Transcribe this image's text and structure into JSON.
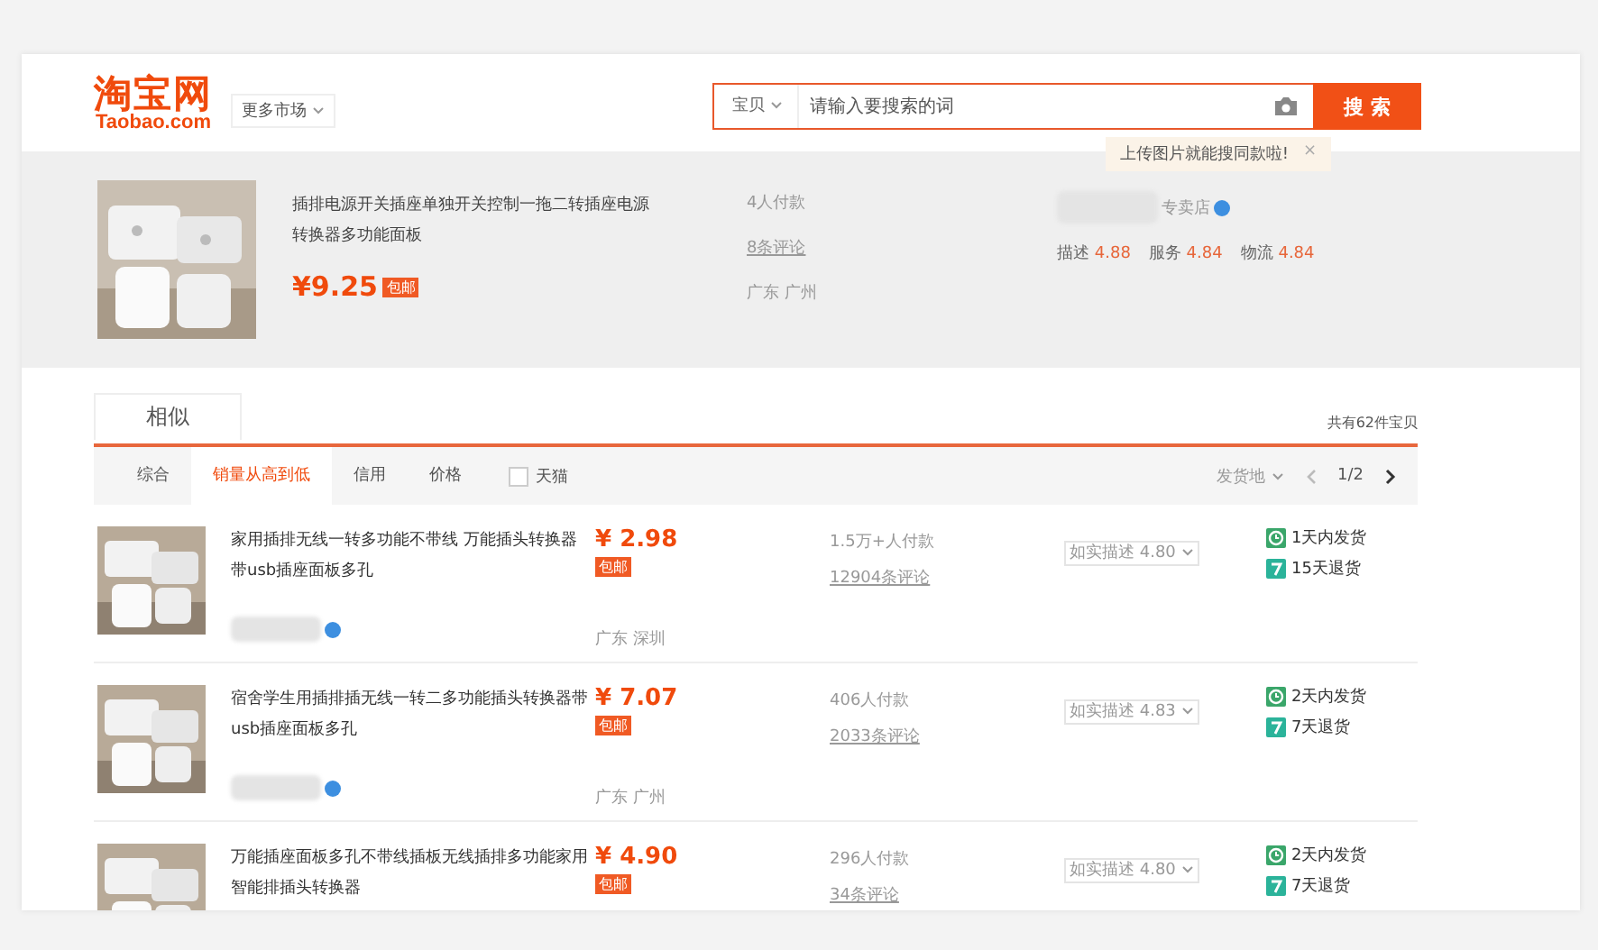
{
  "header": {
    "logo_cn": "淘宝网",
    "logo_en": "Taobao.com",
    "market_button": "更多市场",
    "search": {
      "scope": "宝贝",
      "placeholder": "请输入要搜索的词",
      "button": "搜 索"
    },
    "tooltip": {
      "text": "上传图片就能搜同款啦!",
      "close": "×"
    }
  },
  "featured": {
    "title": "插排电源开关插座单独开关控制一拖二转插座电源转换器多功能面板",
    "price": "¥9.25",
    "tag": "包邮",
    "sales": "4人付款",
    "reviews": "8条评论",
    "location": "广东 广州",
    "shop_suffix": "专卖店",
    "ratings": [
      {
        "label": "描述",
        "value": "4.88"
      },
      {
        "label": "服务",
        "value": "4.84"
      },
      {
        "label": "物流",
        "value": "4.84"
      }
    ]
  },
  "similar_tab": "相似",
  "total": "共有62件宝贝",
  "sort_tabs": [
    {
      "label": "综合",
      "selected": false
    },
    {
      "label": "销量从高到低",
      "selected": true
    },
    {
      "label": "信用",
      "selected": false
    },
    {
      "label": "价格",
      "selected": false
    }
  ],
  "tmall": {
    "label": "天猫",
    "checked": false
  },
  "location_filter": "发货地",
  "pager": "1/2",
  "rows": [
    {
      "title": "家用插排无线一转多功能不带线 万能插头转换器带usb插座面板多孔",
      "price": "¥ 2.98",
      "tag": "包邮",
      "sales": "1.5万+人付款",
      "reviews": "12904条评论",
      "location": "广东 深圳",
      "rating": "如实描述 4.80",
      "services": [
        {
          "text": "1天内发货",
          "kind": "clock"
        },
        {
          "text": "15天退货",
          "kind": "return"
        }
      ]
    },
    {
      "title": "宿舍学生用插排插无线一转二多功能插头转换器带usb插座面板多孔",
      "price": "¥ 7.07",
      "tag": "包邮",
      "sales": "406人付款",
      "reviews": "2033条评论",
      "location": "广东 广州",
      "rating": "如实描述 4.83",
      "services": [
        {
          "text": "2天内发货",
          "kind": "clock"
        },
        {
          "text": "7天退货",
          "kind": "return"
        }
      ]
    },
    {
      "title": "万能插座面板多孔不带线插板无线插排多功能家用智能排插头转换器",
      "price": "¥ 4.90",
      "tag": "包邮",
      "sales": "296人付款",
      "reviews": "34条评论",
      "rating": "如实描述 4.80",
      "services": [
        {
          "text": "2天内发货",
          "kind": "clock"
        },
        {
          "text": "7天退货",
          "kind": "return"
        }
      ]
    }
  ]
}
